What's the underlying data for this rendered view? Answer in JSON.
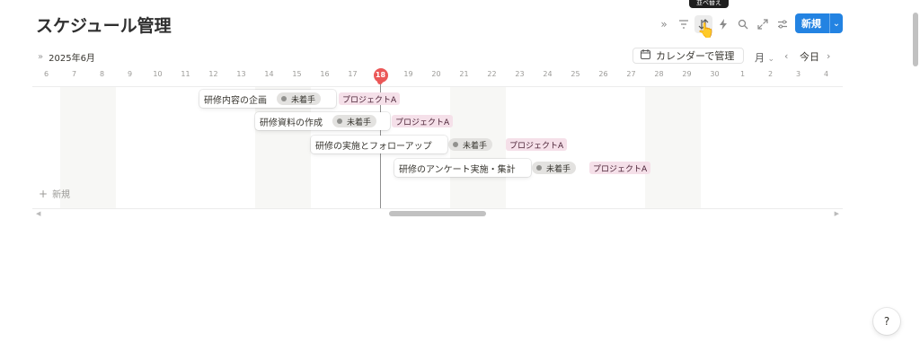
{
  "page": {
    "title": "スケジュール管理"
  },
  "toolbar": {
    "tooltip": "並べ替え",
    "new_label": "新規",
    "icons": [
      "double-chevron-icon",
      "filter-icon",
      "sort-icon",
      "automation-icon",
      "search-icon",
      "expand-icon",
      "settings-icon"
    ]
  },
  "timeline": {
    "month_label": "2025年6月",
    "calendar_button": "カレンダーで管理",
    "view_select": "月",
    "today_label": "今日",
    "days": [
      "6",
      "7",
      "8",
      "9",
      "10",
      "11",
      "12",
      "13",
      "14",
      "15",
      "16",
      "17",
      "18",
      "19",
      "20",
      "21",
      "22",
      "23",
      "24",
      "25",
      "26",
      "27",
      "28",
      "29",
      "30",
      "1",
      "2",
      "3",
      "4"
    ],
    "today": "18",
    "add_new": "新規",
    "colors": {
      "today": "#eb5757",
      "accent": "#2383e2",
      "tag_bg": "#f5e0e9",
      "pill_bg": "#e3e2e0"
    }
  },
  "tasks": [
    {
      "name": "研修内容の企画",
      "status": "未着手",
      "project": "プロジェクトA"
    },
    {
      "name": "研修資料の作成",
      "status": "未着手",
      "project": "プロジェクトA"
    },
    {
      "name": "研修の実施とフォローアップ",
      "status": "未着手",
      "project": "プロジェクトA"
    },
    {
      "name": "研修のアンケート実施・集計",
      "status": "未着手",
      "project": "プロジェクトA"
    }
  ]
}
